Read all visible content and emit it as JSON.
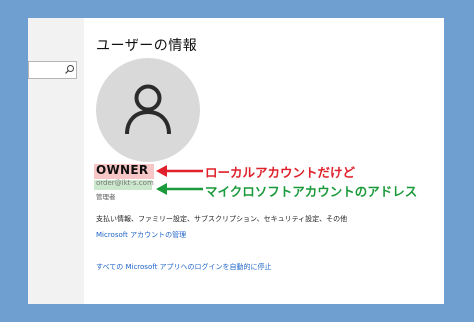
{
  "header": {
    "title": "ユーザーの情報"
  },
  "account": {
    "name": "OWNER",
    "email": "order@ikt-s.com",
    "role": "管理者"
  },
  "annotations": {
    "red": "ローカルアカウントだけど",
    "green": "マイクロソフトアカウントのアドレス"
  },
  "links": {
    "payment_info": "支払い情報、ファミリー設定、サブスクリプション、セキュリティ設定、その他",
    "manage_account": "Microsoft アカウントの管理",
    "stop_auto_signin": "すべての Microsoft アプリへのログインを自動的に停止"
  },
  "colors": {
    "background": "#6f9fd0",
    "annotation_red": "#e0212b",
    "annotation_green": "#1a9a3a",
    "link": "#1e64c8"
  },
  "icons": {
    "search": "search-icon",
    "avatar": "person-icon"
  }
}
